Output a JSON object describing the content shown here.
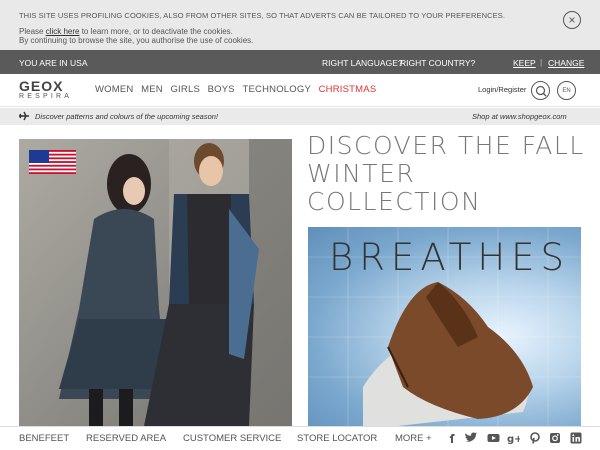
{
  "cookie": {
    "title": "THIS SITE USES PROFILING COOKIES, ALSO FROM OTHER SITES, SO THAT ADVERTS CAN BE TAILORED TO YOUR PREFERENCES.",
    "line1_prefix": "Please ",
    "line1_link": "click here",
    "line1_suffix": " to learn more, or to deactivate the cookies.",
    "line2": "By continuing to browse the site, you authorise the use of cookies.",
    "close_icon": "×"
  },
  "country_bar": {
    "you_are_in": "YOU ARE IN USA",
    "question1": "RIGHT LANGUAGE?",
    "question2": "RIGHT COUNTRY?",
    "keep": "KEEP",
    "separator": "|",
    "change": "CHANGE"
  },
  "header": {
    "logo_main": "GEOX",
    "logo_sub": "RESPIRA",
    "nav": [
      "WOMEN",
      "MEN",
      "GIRLS",
      "BOYS",
      "TECHNOLOGY",
      "CHRISTMAS"
    ],
    "login": "Login/Register",
    "lang": "EN"
  },
  "promo": {
    "text": "Discover patterns and colours of the upcoming season!",
    "shop": "Shop at www.shopgeox.com"
  },
  "hero": {
    "headline": [
      "DISCOVER THE FALL",
      "WINTER",
      "COLLECTION"
    ],
    "product_tagline": "BREATHES"
  },
  "footer": {
    "links": [
      "BENEFEET",
      "RESERVED AREA",
      "CUSTOMER SERVICE",
      "STORE LOCATOR",
      "MORE +"
    ],
    "social_icons": [
      "facebook-icon",
      "twitter-icon",
      "youtube-icon",
      "google-plus-icon",
      "pinterest-icon",
      "instagram-icon",
      "linkedin-icon"
    ]
  },
  "colors": {
    "accent_christmas": "#dd3333",
    "country_bar_bg": "#5a5a5a",
    "cookie_bg": "#e9e9e9"
  }
}
